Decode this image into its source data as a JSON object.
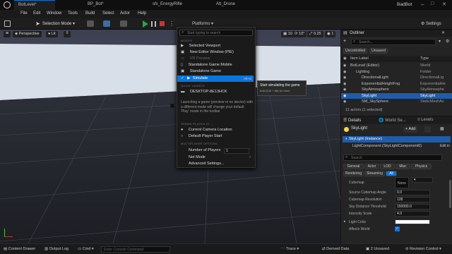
{
  "window": {
    "project": "BadBot",
    "tabs": [
      "BotLevel*",
      "BP_Bot*",
      "sfx_EnergyRifle",
      "Att_Drone"
    ]
  },
  "menu": [
    "File",
    "Edit",
    "Window",
    "Tools",
    "Build",
    "Select",
    "Actor",
    "Help"
  ],
  "toolbar": {
    "save": "",
    "mode": "Selection Mode",
    "platforms": "Platforms",
    "settings": "Settings"
  },
  "viewport": {
    "perspective": "Perspective",
    "lit": "Lit",
    "grid": "10",
    "angle": "10°",
    "scale": "0.25",
    "cam": "1"
  },
  "dropdown": {
    "search_placeholder": "Start typing to search",
    "sec_modes": "MODES",
    "modes": [
      {
        "label": "Selected Viewport"
      },
      {
        "label": "New Editor Window (PIE)"
      },
      {
        "label": "VR Preview",
        "dim": true
      },
      {
        "label": "Standalone Game Mobile"
      },
      {
        "label": "Standalone Game"
      },
      {
        "label": "Simulate",
        "shortcut": "Alt+S",
        "selected": true
      }
    ],
    "sec_quick": "QUICK LAUNCH",
    "device": "DESKTOP-8E13HCK",
    "info": "Launching a game (preview or on device) with a different mode will change your default 'Play' mode in the toolbar",
    "sec_spawn": "SPAWN PLAYER AT...",
    "spawn": [
      "Current Camera Location",
      "Default Player Start"
    ],
    "sec_mp": "MULTIPLAYER OPTIONS",
    "players_label": "Number of Players",
    "players_value": "1",
    "netmode": "Net Mode",
    "advanced": "Advanced Settings..."
  },
  "tooltip": {
    "title": "Start simulating the game",
    "hint": "hold (Ctrl + Alt) for more"
  },
  "outliner": {
    "title": "Outliner",
    "search_placeholder": "Search...",
    "filters": [
      "Uncontrolled",
      "Unsaved"
    ],
    "col_label": "Item Label",
    "col_type": "Type",
    "items": [
      {
        "label": "BotLevel (Editor)",
        "type": "World",
        "indent": 0
      },
      {
        "label": "Lighting",
        "type": "Folder",
        "indent": 1
      },
      {
        "label": "DirectionalLight",
        "type": "DirectionalLig",
        "indent": 2
      },
      {
        "label": "ExponentialHeightFog",
        "type": "ExponentialHe",
        "indent": 2
      },
      {
        "label": "SkyAtmosphere",
        "type": "SkyAtmosphe",
        "indent": 2
      },
      {
        "label": "SkyLight",
        "type": "SkyLight",
        "indent": 2,
        "selected": true
      },
      {
        "label": "SM_SkySphere",
        "type": "StaticMeshAc",
        "indent": 2
      }
    ],
    "status": "11 actors (1 selected)"
  },
  "details": {
    "tabs": [
      "Details",
      "World Se...",
      "Levels"
    ],
    "actor": "SkyLight",
    "add": "Add",
    "component_root": "SkyLight (Instance)",
    "component": "LightComponent (SkyLightComponent0)",
    "edit_in": "Edit in",
    "search_placeholder": "Search",
    "filters1": [
      "General",
      "Actor",
      "LOD",
      "Misc",
      "Physics"
    ],
    "filters2": [
      "Rendering",
      "Streaming",
      "All"
    ],
    "props": [
      {
        "label": "Cubemap",
        "value": "None"
      },
      {
        "label": "Source Cubemap Angle",
        "value": "0.0"
      },
      {
        "label": "Cubemap Resolution",
        "value": "128"
      },
      {
        "label": "Sky Distance Threshold",
        "value": "150000.0"
      },
      {
        "label": "Intensity Scale",
        "value": "4.0"
      },
      {
        "label": "Light Color",
        "value": ""
      },
      {
        "label": "Affects World",
        "value": ""
      }
    ]
  },
  "status": {
    "content_drawer": "Content Drawer",
    "output_log": "Output Log",
    "cmd": "Cmd",
    "console_placeholder": "Enter Console Command",
    "trace": "Trace",
    "derived": "Derived Data",
    "unsaved": "2 Unsaved",
    "revision": "Revision Control"
  },
  "colors": {
    "accent": "#0a75dd",
    "play": "#2ea043",
    "select": "#1f5caa"
  }
}
